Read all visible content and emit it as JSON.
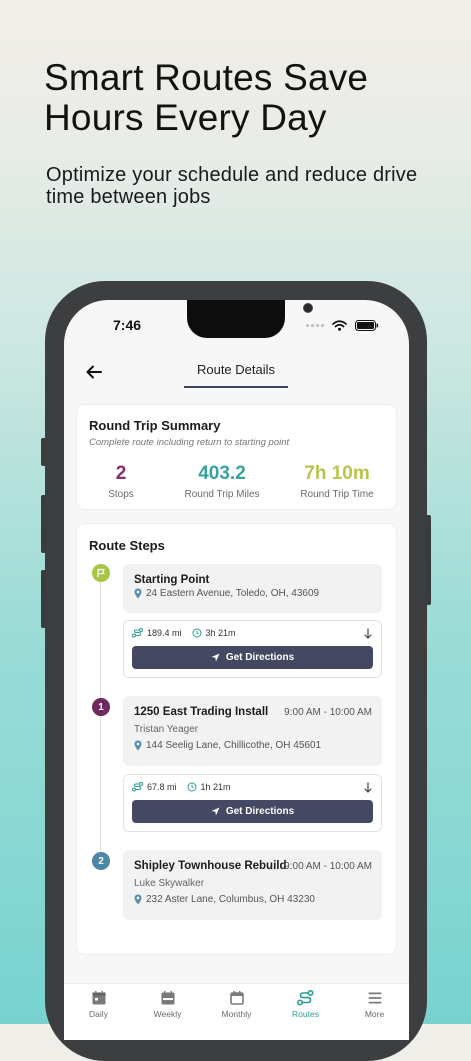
{
  "hero": {
    "title": "Smart Routes Save Hours Every Day",
    "subtitle": "Optimize your schedule and reduce drive time between jobs"
  },
  "status_bar": {
    "time": "7:46"
  },
  "header": {
    "title": "Route Details"
  },
  "summary": {
    "title": "Round Trip Summary",
    "description": "Complete route including return to starting point",
    "stats": [
      {
        "value": "2",
        "label": "Stops",
        "color": "#8a2e6b"
      },
      {
        "value": "403.2",
        "label": "Round Trip Miles",
        "color": "#3aa29d"
      },
      {
        "value": "7h 10m",
        "label": "Round Trip Time",
        "color": "#b9c54a"
      }
    ]
  },
  "steps": {
    "title": "Route Steps",
    "start": {
      "name": "Starting Point",
      "address": "24 Eastern Avenue, Toledo, OH, 43609",
      "marker_color": "#a7c644",
      "icon": "flag-icon"
    },
    "stops": [
      {
        "number": "1",
        "name": "1250 East Trading Install",
        "time": "9:00 AM - 10:00 AM",
        "person": "Tristan Yeager",
        "address": "144 Seelig Lane, Chillicothe, OH 45601",
        "marker_color": "#6e2a5c"
      },
      {
        "number": "2",
        "name": "Shipley Townhouse Rebuild",
        "time": "9:00 AM - 10:00 AM",
        "person": "Luke Skywalker",
        "address": "232 Aster Lane, Columbus, OH 43230",
        "marker_color": "#4f86a8"
      }
    ],
    "legs": [
      {
        "distance": "189.4 mi",
        "duration": "3h 21m",
        "button": "Get Directions"
      },
      {
        "distance": "67.8 mi",
        "duration": "1h 21m",
        "button": "Get Directions"
      }
    ]
  },
  "tabs": [
    {
      "label": "Daily",
      "icon": "calendar-day-icon",
      "active": false
    },
    {
      "label": "Weekly",
      "icon": "calendar-week-icon",
      "active": false
    },
    {
      "label": "Monthly",
      "icon": "calendar-month-icon",
      "active": false
    },
    {
      "label": "Routes",
      "icon": "route-icon",
      "active": true
    },
    {
      "label": "More",
      "icon": "menu-icon",
      "active": false
    }
  ],
  "colors": {
    "accent": "#2e9b96",
    "button": "#454862",
    "pin": "#5b8fb0"
  }
}
